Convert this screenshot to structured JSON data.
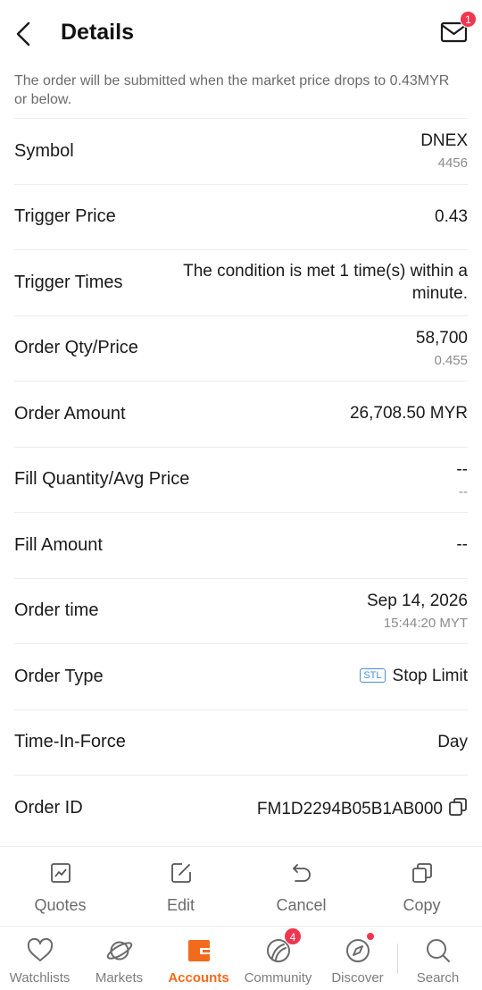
{
  "header": {
    "title": "Details",
    "mail_badge": "1"
  },
  "notice": "The order will be submitted when the market price drops to 0.43MYR or below.",
  "rows": [
    {
      "label": "Symbol",
      "value": "DNEX",
      "sub": "4456"
    },
    {
      "label": "Trigger Price",
      "value": "0.43"
    },
    {
      "label": "Trigger Times",
      "value": "The condition is met 1 time(s) within a minute."
    },
    {
      "label": "Order Qty/Price",
      "value": "58,700",
      "sub": "0.455"
    },
    {
      "label": "Order Amount",
      "value": "26,708.50 MYR"
    },
    {
      "label": "Fill Quantity/Avg Price",
      "value": "--",
      "sub": "--"
    },
    {
      "label": "Fill Amount",
      "value": "--"
    },
    {
      "label": "Order time",
      "value": "Sep 14, 2026",
      "sub": "15:44:20 MYT"
    },
    {
      "label": "Order Type",
      "tag": "STL",
      "value": "Stop Limit"
    },
    {
      "label": "Time-In-Force",
      "value": "Day"
    },
    {
      "label": "Order ID",
      "value": "FM1D2294B05B1AB000"
    }
  ],
  "actions": [
    {
      "label": "Quotes",
      "icon": "chart-icon"
    },
    {
      "label": "Edit",
      "icon": "edit-icon"
    },
    {
      "label": "Cancel",
      "icon": "undo-icon"
    },
    {
      "label": "Copy",
      "icon": "copy-icon"
    }
  ],
  "tabs": [
    {
      "label": "Watchlists",
      "icon": "heart-icon"
    },
    {
      "label": "Markets",
      "icon": "planet-icon"
    },
    {
      "label": "Accounts",
      "icon": "wallet-icon",
      "active": true
    },
    {
      "label": "Community",
      "icon": "moon-icon",
      "badge": "4"
    },
    {
      "label": "Discover",
      "icon": "compass-icon"
    },
    {
      "label": "Search",
      "icon": "search-icon"
    }
  ],
  "colors": {
    "accent": "#f26b1d",
    "badge": "#f0364f",
    "tag": "#4a90d9"
  }
}
